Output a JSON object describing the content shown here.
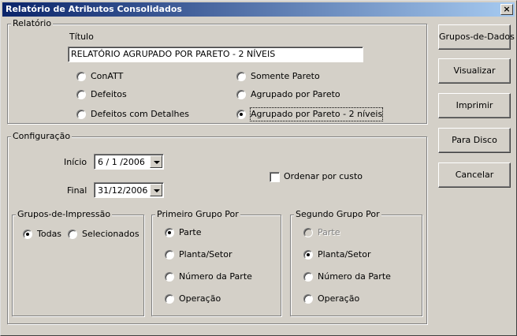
{
  "window": {
    "title": "Relatório de Atributos Consolidados",
    "close_label": "×"
  },
  "relatorio": {
    "legend": "Relatório",
    "titulo_label": "Título",
    "titulo_value": "RELATÓRIO AGRUPADO POR  PARETO - 2 NÍVEIS",
    "options": [
      {
        "label": "ConATT",
        "selected": false
      },
      {
        "label": "Defeitos",
        "selected": false
      },
      {
        "label": "Defeitos com Detalhes",
        "selected": false
      },
      {
        "label": "Somente Pareto",
        "selected": false
      },
      {
        "label": "Agrupado por Pareto",
        "selected": false
      },
      {
        "label": "Agrupado por Pareto - 2 níveis",
        "selected": true
      }
    ]
  },
  "configuracao": {
    "legend": "Configuração",
    "inicio_label": "Início",
    "inicio_value": "6 / 1 /2006",
    "final_label": "Final",
    "final_value": "31/12/2006",
    "ordenar_label": "Ordenar por custo",
    "ordenar_checked": false
  },
  "grupos_impressao": {
    "legend": "Grupos-de-Impressão",
    "options": [
      {
        "label": "Todas",
        "selected": true
      },
      {
        "label": "Selecionados",
        "selected": false
      }
    ]
  },
  "primeiro_grupo": {
    "legend": "Primeiro Grupo Por",
    "options": [
      {
        "label": "Parte",
        "selected": true
      },
      {
        "label": "Planta/Setor",
        "selected": false
      },
      {
        "label": "Número da Parte",
        "selected": false
      },
      {
        "label": "Operação",
        "selected": false
      }
    ]
  },
  "segundo_grupo": {
    "legend": "Segundo Grupo Por",
    "options": [
      {
        "label": "Parte",
        "selected": false,
        "disabled": true
      },
      {
        "label": "Planta/Setor",
        "selected": true
      },
      {
        "label": "Número da Parte",
        "selected": false
      },
      {
        "label": "Operação",
        "selected": false
      }
    ]
  },
  "buttons": {
    "grupos_dados": "Grupos-de-Dados",
    "visualizar": "Visualizar",
    "imprimir": "Imprimir",
    "para_disco": "Para Disco",
    "cancelar": "Cancelar"
  }
}
